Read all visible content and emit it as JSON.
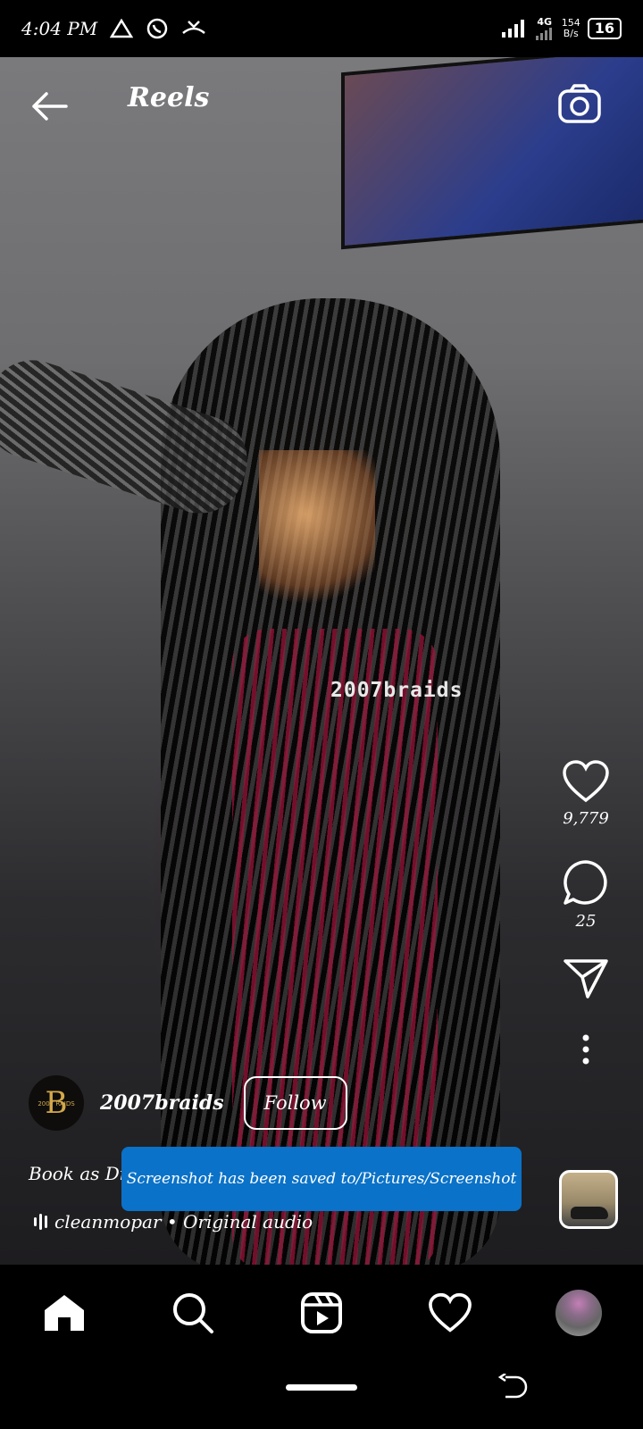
{
  "status_bar": {
    "time": "4:04 PM",
    "network": "4G",
    "speed_top": "154",
    "speed_bottom": "B/s",
    "battery": "16",
    "icons": [
      "drive-icon",
      "whatsapp-icon",
      "missed-call-icon",
      "signal-icon",
      "battery-icon"
    ]
  },
  "header": {
    "title": "Reels",
    "back_icon": "arrow-left-icon",
    "camera_icon": "camera-icon"
  },
  "video": {
    "watermark": "2007braids"
  },
  "actions": {
    "likes": "9,779",
    "comments": "25",
    "icons": [
      "heart-icon",
      "comment-icon",
      "send-icon",
      "more-icon"
    ]
  },
  "post": {
    "avatar_letter": "B",
    "avatar_small": "2007    RAIDS",
    "username": "2007braids",
    "follow_label": "Follow",
    "caption": "Book as Di",
    "audio": "cleanmopar • Original audio"
  },
  "toast": {
    "message": "Screenshot has been saved to/Pictures/Screenshot"
  },
  "nav": {
    "items": [
      "home-icon",
      "search-icon",
      "reels-icon",
      "activity-heart-icon",
      "profile-avatar"
    ]
  },
  "colors": {
    "toast_bg": "#0a72c8",
    "background": "#000000",
    "text": "#ffffff"
  }
}
